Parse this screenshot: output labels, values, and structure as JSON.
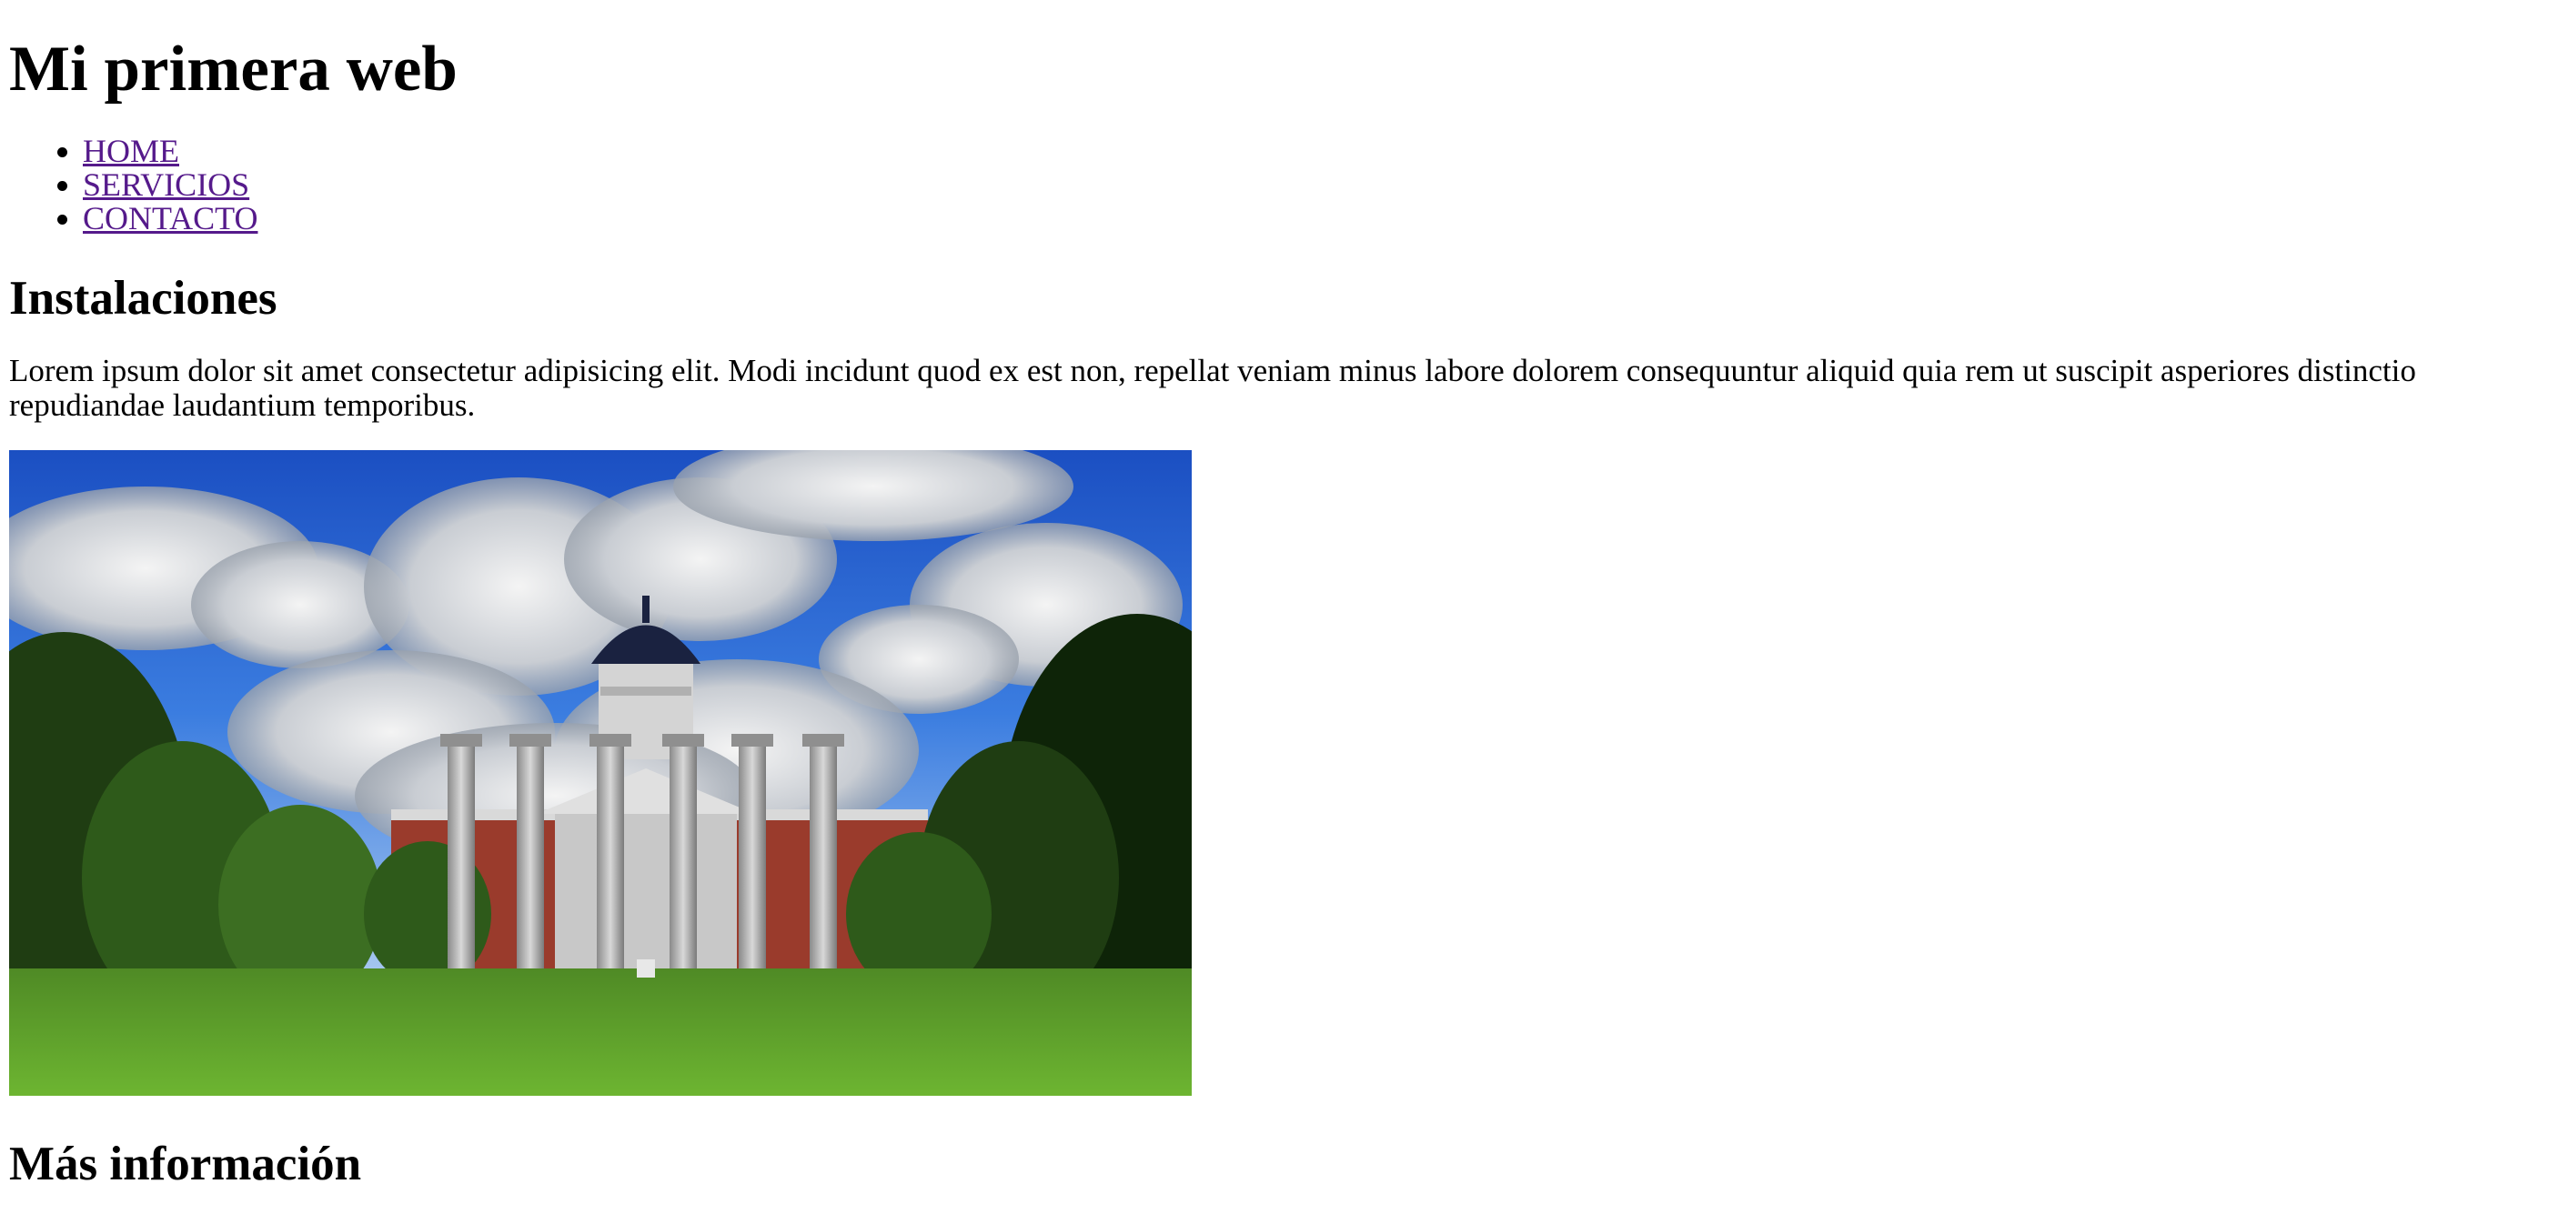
{
  "page": {
    "title": "Mi primera web"
  },
  "nav": {
    "items": [
      {
        "label": "HOME"
      },
      {
        "label": "SERVICIOS"
      },
      {
        "label": "CONTACTO"
      }
    ],
    "link_color": "#551a8b"
  },
  "section": {
    "title": "Instalaciones",
    "text": "Lorem ipsum dolor sit amet consectetur adipisicing elit. Modi incidunt quod ex est non, repellat veniam minus labore dolorem consequuntur aliquid quia rem ut suscipit asperiores distinctio repudiandae laudantium temporibus."
  },
  "image": {
    "subject": "university-building-columns"
  },
  "more": {
    "title": "Más información"
  }
}
